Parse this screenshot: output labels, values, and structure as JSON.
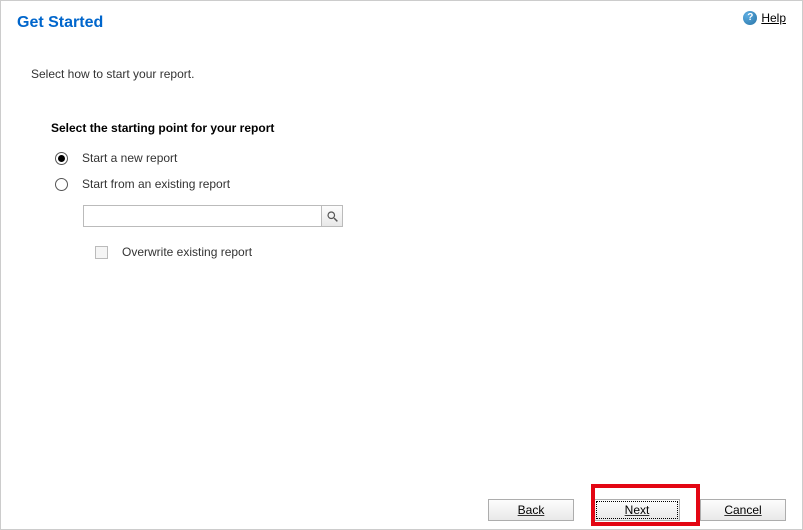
{
  "header": {
    "title": "Get Started",
    "help_label": "Help"
  },
  "intro_text": "Select how to start your report.",
  "section": {
    "heading": "Select the starting point for your report",
    "option_new": "Start a new report",
    "option_existing": "Start from an existing report",
    "existing_path": "",
    "overwrite_label": "Overwrite existing report"
  },
  "footer": {
    "back_label": "Back",
    "next_label": "Next",
    "cancel_label": "Cancel"
  },
  "highlight": {
    "target": "next-button"
  }
}
